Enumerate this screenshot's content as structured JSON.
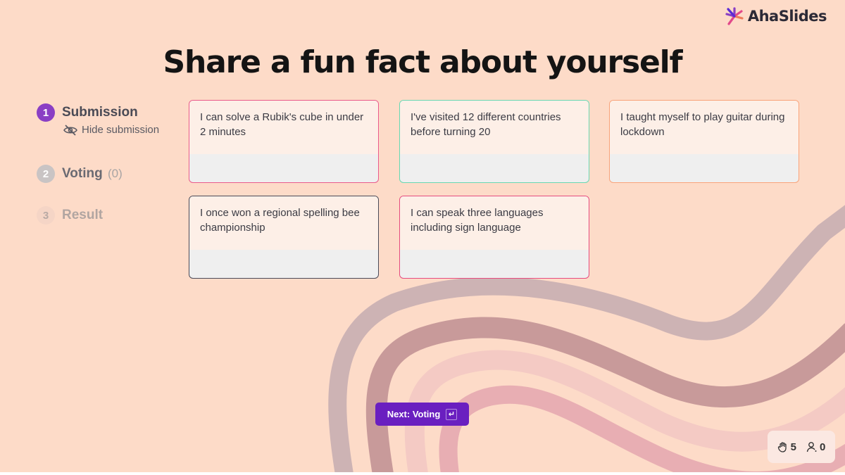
{
  "brand": {
    "name": "AhaSlides"
  },
  "title": "Share a fun fact about yourself",
  "steps": [
    {
      "number": "1",
      "label": "Submission",
      "state": "active",
      "sub_action": "Hide submission"
    },
    {
      "number": "2",
      "label": "Voting",
      "count": "(0)",
      "state": "pending"
    },
    {
      "number": "3",
      "label": "Result",
      "state": "disabled"
    }
  ],
  "submissions": [
    {
      "text": "I can solve a Rubik's cube in under 2 minutes",
      "border_color": "#ea5a8a"
    },
    {
      "text": "I've visited 12 different countries before turning 20",
      "border_color": "#67d8b2"
    },
    {
      "text": "I taught myself to play guitar during lockdown",
      "border_color": "#f9a37a"
    },
    {
      "text": "I once won a regional spelling bee championship",
      "border_color": "#4a4a58"
    },
    {
      "text": "I can speak three languages including sign language",
      "border_color": "#e64c7e"
    }
  ],
  "next_button": {
    "label": "Next: Voting",
    "key_icon": "enter-key-icon"
  },
  "stats": {
    "reactions": "5",
    "participants": "0"
  },
  "colors": {
    "accent": "#6a1fc0",
    "step_active": "#8a3fc4",
    "background": "#fddbc8"
  }
}
